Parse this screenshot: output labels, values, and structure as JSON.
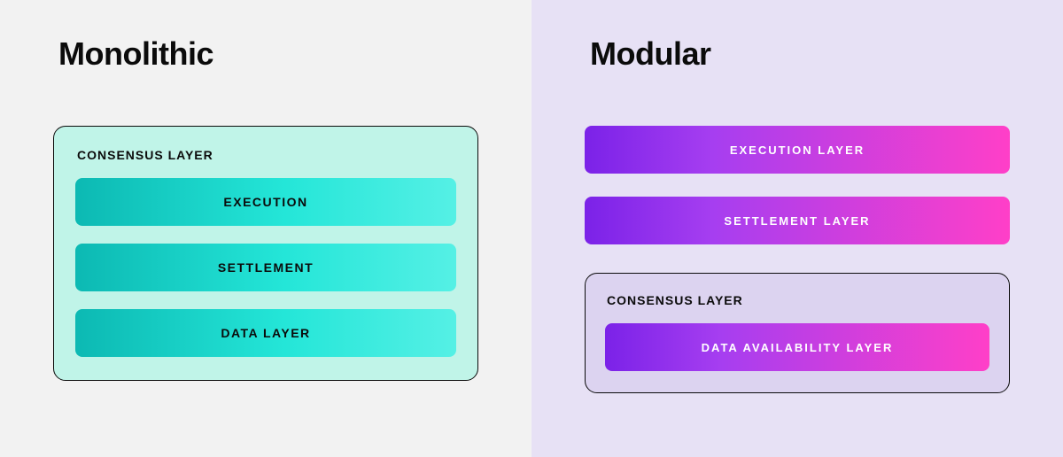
{
  "left": {
    "title": "Monolithic",
    "box_heading": "Consensus Layer",
    "bars": [
      "Execution",
      "Settlement",
      "Data Layer"
    ]
  },
  "right": {
    "title": "Modular",
    "top_bars": [
      "Execution  Layer",
      "Settlement Layer"
    ],
    "box_heading": "Consensus Layer",
    "box_bar": "Data Availability Layer"
  }
}
